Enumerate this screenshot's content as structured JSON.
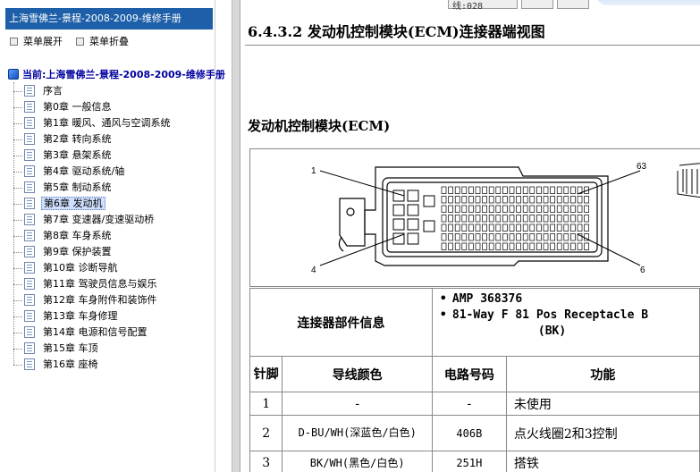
{
  "sidebar": {
    "title": "上海雪佛兰-景程-2008-2009-维修手册",
    "expand_label": "菜单展开",
    "collapse_label": "菜单折叠",
    "root_label": "当前:上海雪佛兰-景程-2008-2009-维修手册",
    "selected_index": 7,
    "items": [
      {
        "label": "序言"
      },
      {
        "label": "第0章 一般信息"
      },
      {
        "label": "第1章 暖风、通风与空调系统"
      },
      {
        "label": "第2章 转向系统"
      },
      {
        "label": "第3章 悬架系统"
      },
      {
        "label": "第4章 驱动系统/轴"
      },
      {
        "label": "第5章 制动系统"
      },
      {
        "label": "第6章 发动机"
      },
      {
        "label": "第7章 变速器/变速驱动桥"
      },
      {
        "label": "第8章 车身系统"
      },
      {
        "label": "第9章 保护装置"
      },
      {
        "label": "第10章 诊断导航"
      },
      {
        "label": "第11章 驾驶员信息与娱乐"
      },
      {
        "label": "第12章 车身附件和装饰件"
      },
      {
        "label": "第13章 车身修理"
      },
      {
        "label": "第14章 电源和信号配置"
      },
      {
        "label": "第15章 车顶"
      },
      {
        "label": "第16章 座椅"
      }
    ]
  },
  "topbar": {
    "page_fragment": "线:028"
  },
  "content": {
    "heading": "6.4.3.2 发动机控制模块(ECM)连接器端视图",
    "module_heading": "发动机控制模块(ECM)",
    "figure": {
      "callouts": [
        "1",
        "63",
        "4",
        "6"
      ]
    },
    "info": {
      "label": "连接器部件信息",
      "bullets": [
        "AMP 368376",
        "81-Way F 81 Pos Receptacle B"
      ],
      "bullet_tail": "(BK)"
    },
    "table": {
      "headers": [
        "针脚",
        "导线颜色",
        "电路号码",
        "功能"
      ],
      "rows": [
        {
          "pin": "1",
          "color": "-",
          "circuit": "-",
          "function": "未使用"
        },
        {
          "pin": "2",
          "color": "D-BU/WH(深蓝色/白色)",
          "circuit": "406B",
          "function": "点火线圈2和3控制"
        },
        {
          "pin": "3",
          "color": "BK/WH(黑色/白色)",
          "circuit": "251H",
          "function": "搭铁"
        }
      ]
    }
  }
}
